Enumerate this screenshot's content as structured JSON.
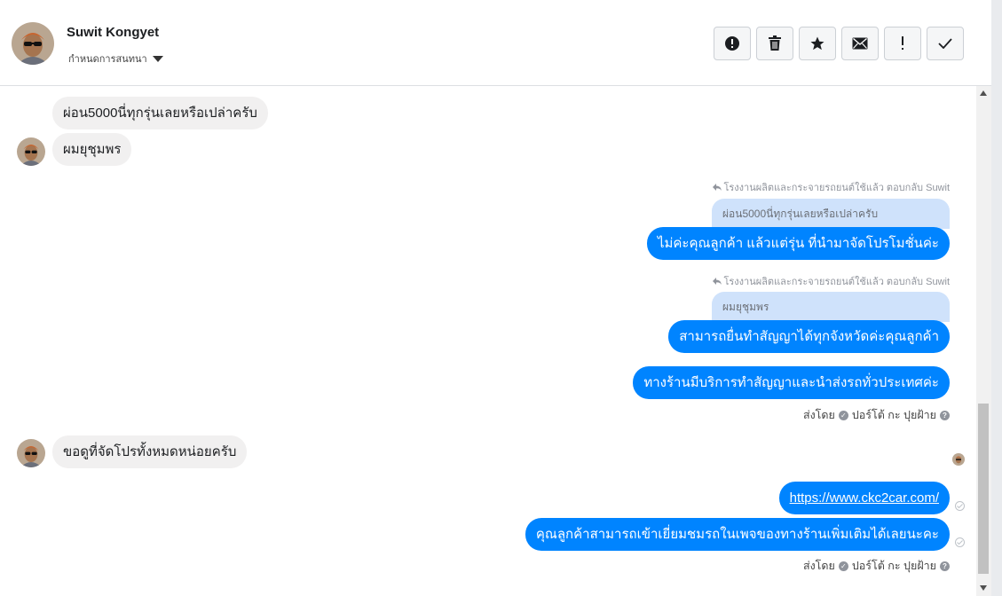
{
  "header": {
    "name": "Suwit Kongyet",
    "subtitle": "กำหนดการสนทนา",
    "avatar_icon": "user-avatar-photo"
  },
  "toolbar": {
    "buttons": [
      {
        "icon": "alert-circle-icon",
        "label": "Mark as spam"
      },
      {
        "icon": "trash-icon",
        "label": "Delete"
      },
      {
        "icon": "star-icon",
        "label": "Star"
      },
      {
        "icon": "envelope-icon",
        "label": "Mark as unread"
      },
      {
        "icon": "exclamation-icon",
        "label": "Follow up"
      },
      {
        "icon": "check-icon",
        "label": "Done"
      }
    ]
  },
  "messages": {
    "m1": "ผ่อน5000นี่ทุกรุ่นเลยหรือเปล่าครับ",
    "m2": "ผมยุชุมพร",
    "reply1_note": "โรงงานผลิตและกระจายรถยนต์ใช้แล้ว ตอบกลับ Suwit",
    "reply1_quote": "ผ่อน5000นี่ทุกรุ่นเลยหรือเปล่าครับ",
    "reply1_text": "ไม่ค่ะคุณลูกค้า แล้วแต่รุ่น ที่นำมาจัดโปรโมชั่นค่ะ",
    "reply2_note": "โรงงานผลิตและกระจายรถยนต์ใช้แล้ว ตอบกลับ Suwit",
    "reply2_quote": "ผมยุชุมพร",
    "reply2_text": "สามารถยื่นทำสัญญาได้ทุกจังหวัดค่ะคุณลูกค้า",
    "out3": "ทางร้านมีบริการทำสัญญาและนำส่งรถทั่วประเทศค่ะ",
    "sent_by_prefix": "ส่งโดย",
    "sent_by_name": "ปอร์โต้ กะ ปุยฝ้าย",
    "m3": "ขอดูที่จัดโปรทั้งหมดหน่อยครับ",
    "link": "https://www.ckc2car.com/",
    "out5": "คุณลูกค้าสามารถเข้าเยี่ยมชมรถในเพจของทางร้านเพิ่มเติมได้เลยนะคะ",
    "sent_by_prefix2": "ส่งโดย",
    "sent_by_name2": "ปอร์โต้ กะ ปุยฝ้าย"
  },
  "colors": {
    "outgoing_bubble": "#0084ff",
    "incoming_bubble": "#f1f0f0",
    "quote_bubble": "#cfe2fb"
  }
}
